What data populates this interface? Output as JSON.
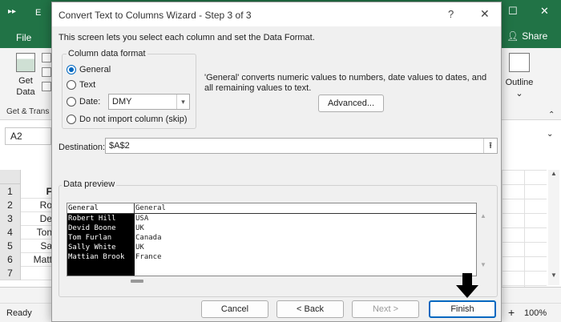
{
  "excel": {
    "title_fragment": "E",
    "file_tab": "File",
    "share_label": "Share",
    "get_data_line1": "Get",
    "get_data_line2": "Data",
    "group_label": "Get & Trans",
    "outline_label": "Outline",
    "name_box": "A2",
    "row_numbers": [
      "1",
      "2",
      "3",
      "4",
      "5",
      "6",
      "7"
    ],
    "col_a_cells": [
      "F",
      "Ro",
      "De",
      "Ton",
      "Sa",
      "Matt",
      ""
    ],
    "status_ready": "Ready",
    "zoom": "100%"
  },
  "dialog": {
    "title": "Convert Text to Columns Wizard - Step 3 of 3",
    "help_glyph": "?",
    "close_glyph": "✕",
    "description": "This screen lets you select each column and set the Data Format.",
    "format_group_label": "Column data format",
    "options": {
      "general": "General",
      "text": "Text",
      "date": "Date:",
      "skip": "Do not import column (skip)"
    },
    "selected_option": "general",
    "date_format": "DMY",
    "general_note": "'General' converts numeric values to numbers, date values to dates, and all remaining values to text.",
    "advanced_button": "Advanced...",
    "destination_label": "Destination:",
    "destination_value": "$A$2",
    "preview_label": "Data preview",
    "preview": {
      "columns": [
        {
          "header": "General",
          "cells": [
            "Robert Hill",
            "Devid Boone",
            "Tom Furlan",
            "Sally White",
            "Mattian Brook"
          ]
        },
        {
          "header": "General",
          "cells": [
            "USA",
            "UK",
            "Canada",
            "UK",
            "France"
          ]
        }
      ]
    },
    "buttons": {
      "cancel": "Cancel",
      "back": "< Back",
      "next": "Next >",
      "finish": "Finish"
    }
  },
  "colors": {
    "excel_green": "#217346",
    "accent_blue": "#0067c0"
  }
}
